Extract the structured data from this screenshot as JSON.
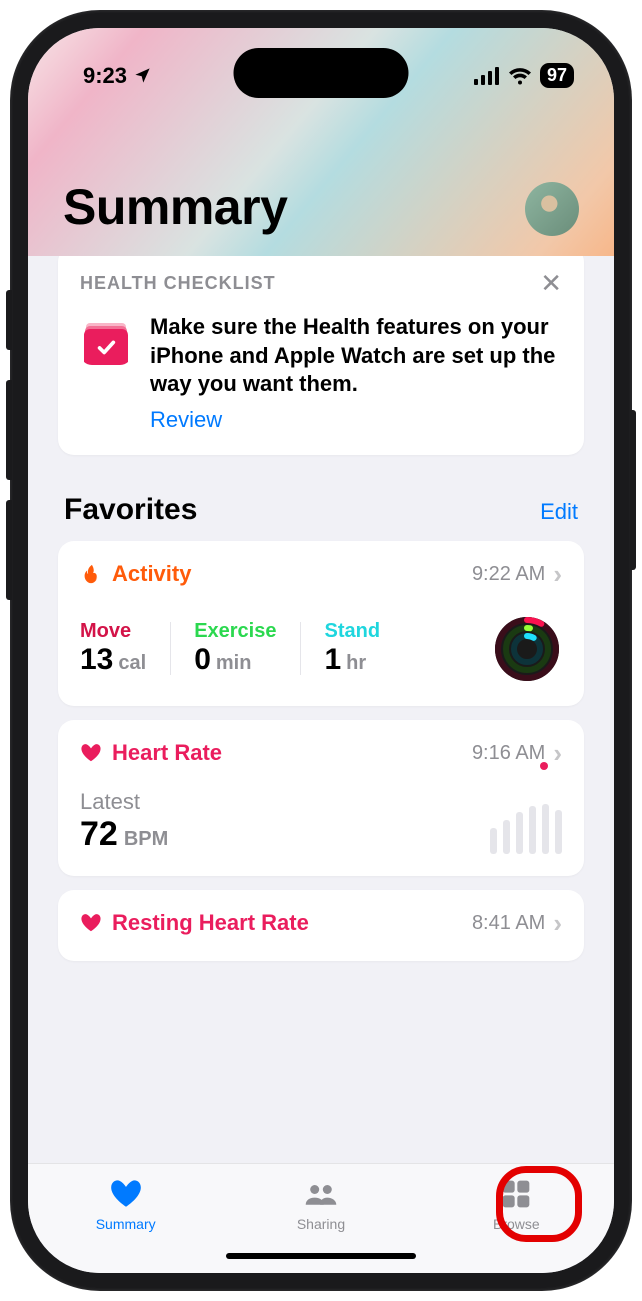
{
  "status": {
    "time": "9:23",
    "battery": "97"
  },
  "header": {
    "title": "Summary"
  },
  "checklist": {
    "label": "HEALTH CHECKLIST",
    "text": "Make sure the Health features on your iPhone and Apple Watch are set up the way you want them.",
    "action": "Review"
  },
  "favorites": {
    "title": "Favorites",
    "edit": "Edit"
  },
  "activity": {
    "title": "Activity",
    "time": "9:22 AM",
    "move": {
      "label": "Move",
      "value": "13",
      "unit": "cal"
    },
    "exercise": {
      "label": "Exercise",
      "value": "0",
      "unit": "min"
    },
    "stand": {
      "label": "Stand",
      "value": "1",
      "unit": "hr"
    }
  },
  "heartRate": {
    "title": "Heart Rate",
    "time": "9:16 AM",
    "label": "Latest",
    "value": "72",
    "unit": "BPM"
  },
  "resting": {
    "title": "Resting Heart Rate",
    "time": "8:41 AM"
  },
  "tabs": {
    "summary": "Summary",
    "sharing": "Sharing",
    "browse": "Browse"
  }
}
